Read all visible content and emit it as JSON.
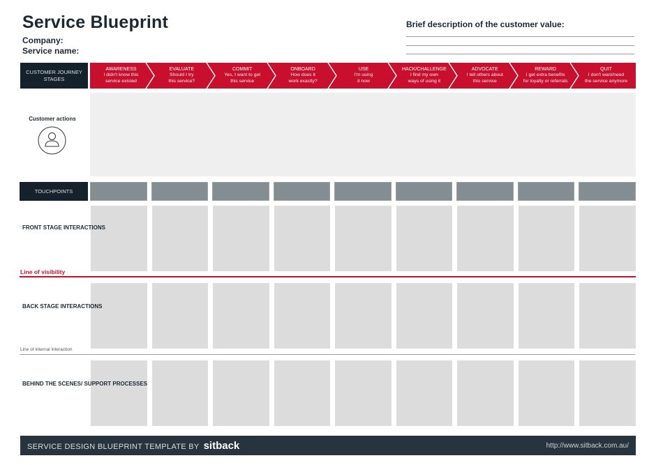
{
  "header": {
    "title": "Service Blueprint",
    "company_label": "Company:",
    "service_name_label": "Service name:",
    "customer_value_label": "Brief description of the customer value:"
  },
  "journey": {
    "label": "CUSTOMER JOURNEY STAGES",
    "stages": [
      {
        "title": "AWARENESS",
        "line1": "I didn't know this",
        "line2": "service existed"
      },
      {
        "title": "EVALUATE",
        "line1": "Should I try",
        "line2": "this service?"
      },
      {
        "title": "COMMIT",
        "line1": "Yes, I want to get",
        "line2": "this service"
      },
      {
        "title": "ONBOARD",
        "line1": "How does it",
        "line2": "work exactly?"
      },
      {
        "title": "USE",
        "line1": "I'm using",
        "line2": "it now"
      },
      {
        "title": "HACK/CHALLENGE",
        "line1": "I find my own",
        "line2": "ways of using it"
      },
      {
        "title": "ADVOCATE",
        "line1": "I tell others about",
        "line2": "this service"
      },
      {
        "title": "REWARD",
        "line1": "I get extra benefits",
        "line2": "for loyalty or referrals"
      },
      {
        "title": "QUIT",
        "line1": "I don't want/need",
        "line2": "the service anymore"
      }
    ]
  },
  "customer_actions": {
    "label": "Customer actions",
    "icon": "user-icon"
  },
  "touchpoints": {
    "label": "TOUCHPOINTS"
  },
  "rows": {
    "front_stage": "FRONT STAGE INTERACTIONS",
    "back_stage": "BACK STAGE INTERACTIONS",
    "support": "BEHIND THE SCENES/ SUPPORT PROCESSES"
  },
  "lines": {
    "visibility": "Line of visibility",
    "internal": "Line of internal interaction"
  },
  "footer": {
    "text": "SERVICE DESIGN BLUEPRINT TEMPLATE BY",
    "brand": "sitback",
    "url": "http://www.sitback.com.au/"
  },
  "colors": {
    "accent_red": "#c8102e",
    "dark_navy": "#16222b",
    "footer_bg": "#28343d",
    "touchpoint_gray": "#848d91",
    "cell_gray": "#dcdcdc",
    "actions_bg": "#efefef"
  }
}
